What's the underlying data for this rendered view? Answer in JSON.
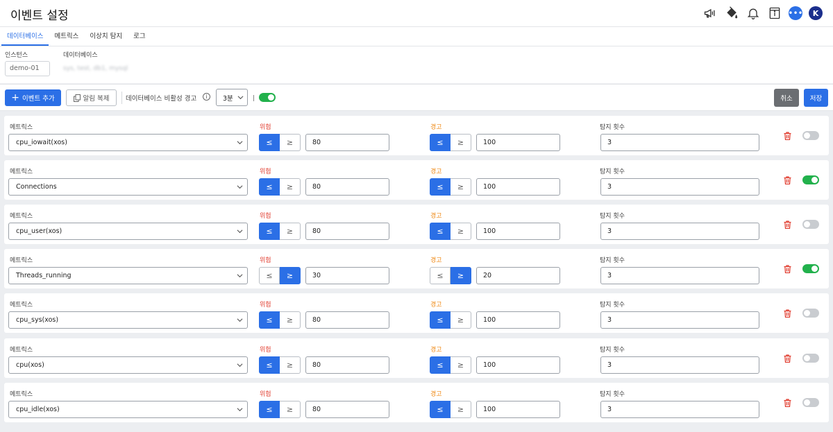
{
  "header": {
    "title": "이벤트 설정",
    "icons": [
      "megaphone-icon",
      "paint-bucket-icon",
      "bell-icon",
      "document-info-icon",
      "chat-icon",
      "avatar"
    ],
    "avatar_letter": "K",
    "chat_glyph": "•••"
  },
  "tabs": [
    {
      "label": "데이터베이스",
      "active": true
    },
    {
      "label": "메트릭스",
      "active": false
    },
    {
      "label": "이상치 탐지",
      "active": false
    },
    {
      "label": "로그",
      "active": false
    }
  ],
  "filters": {
    "instance_label": "인스턴스",
    "instance_value": "demo-01",
    "database_label": "데이터베이스",
    "database_value": "sys, test, db1, mysql"
  },
  "toolbar": {
    "add_event_label": "이벤트 추가",
    "copy_alert_label": "알림 복제",
    "inactivity_label": "데이터베이스 비활성 경고",
    "interval_value": "3분",
    "inactivity_enabled": true,
    "cancel_label": "취소",
    "save_label": "저장"
  },
  "row_labels": {
    "metric": "메트릭스",
    "danger": "위험",
    "warning": "경고",
    "detect_count": "탐지 횟수"
  },
  "operators": {
    "le": "≤",
    "ge": "≥"
  },
  "colors": {
    "primary": "#2b6fe6",
    "danger": "#e0392b",
    "warning": "#ef8a17",
    "toggle_on": "#22b14c"
  },
  "events": [
    {
      "metric": "cpu_iowait(xos)",
      "danger_op": "le",
      "danger_value": "80",
      "warning_op": "le",
      "warning_value": "100",
      "detect_count": "3",
      "enabled": false
    },
    {
      "metric": "Connections",
      "danger_op": "le",
      "danger_value": "80",
      "warning_op": "le",
      "warning_value": "100",
      "detect_count": "3",
      "enabled": true
    },
    {
      "metric": "cpu_user(xos)",
      "danger_op": "le",
      "danger_value": "80",
      "warning_op": "le",
      "warning_value": "100",
      "detect_count": "3",
      "enabled": false
    },
    {
      "metric": "Threads_running",
      "danger_op": "ge",
      "danger_value": "30",
      "warning_op": "ge",
      "warning_value": "20",
      "detect_count": "3",
      "enabled": true
    },
    {
      "metric": "cpu_sys(xos)",
      "danger_op": "le",
      "danger_value": "80",
      "warning_op": "le",
      "warning_value": "100",
      "detect_count": "3",
      "enabled": false
    },
    {
      "metric": "cpu(xos)",
      "danger_op": "le",
      "danger_value": "80",
      "warning_op": "le",
      "warning_value": "100",
      "detect_count": "3",
      "enabled": false
    },
    {
      "metric": "cpu_idle(xos)",
      "danger_op": "le",
      "danger_value": "80",
      "warning_op": "le",
      "warning_value": "100",
      "detect_count": "3",
      "enabled": false
    }
  ]
}
